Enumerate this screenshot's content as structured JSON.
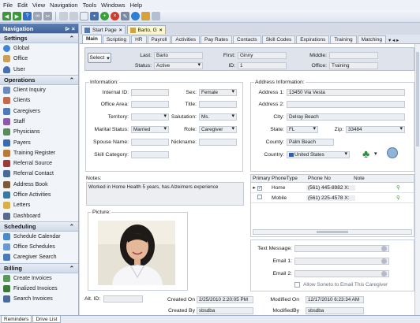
{
  "menu": [
    "File",
    "Edit",
    "View",
    "Navigation",
    "Tools",
    "Windows",
    "Help"
  ],
  "nav": {
    "title": "Navigation",
    "pin": "⊳ ×",
    "sections": [
      {
        "label": "Settings",
        "items": [
          "Global",
          "Office",
          "User"
        ]
      },
      {
        "label": "Operations",
        "items": [
          "Client Inquiry",
          "Clients",
          "Caregivers",
          "Staff",
          "Physicians",
          "Payers",
          "Training Register",
          "Referral Source",
          "Referral Contact",
          "Address Book",
          "Office Activities",
          "Letters",
          "Dashboard"
        ]
      },
      {
        "label": "Scheduling",
        "items": [
          "Schedule Calendar",
          "Office Schedules",
          "Caregiver Search"
        ]
      },
      {
        "label": "Billing",
        "items": [
          "Create Invoices",
          "Finalized Invoices",
          "Search Invoices"
        ]
      }
    ]
  },
  "bottom_tabs": [
    "Reminders",
    "Drive List"
  ],
  "doc_tabs": [
    "Start Page",
    "Barto, G"
  ],
  "sub_tabs": [
    "Main",
    "Scripting",
    "HR",
    "Payroll",
    "Activities",
    "Pay Rates",
    "Contacts",
    "Skill Codes",
    "Expirations",
    "Training",
    "Matching"
  ],
  "header": {
    "select_label": "Select",
    "last_label": "Last:",
    "last": "Barto",
    "first_label": "First:",
    "first": "Ginny",
    "middle_label": "Middle:",
    "middle": "",
    "status_label": "Status:",
    "status": "Active",
    "id_label": "ID:",
    "id": "1",
    "office_label": "Office:",
    "office": "Training"
  },
  "info": {
    "title": "Information:",
    "internal_id_label": "Internal ID:",
    "internal_id": "",
    "sex_label": "Sex:",
    "sex": "Female",
    "office_area_label": "Office Area:",
    "office_area": "",
    "title_label": "Title:",
    "title_value": "",
    "territory_label": "Territory:",
    "territory": "",
    "salutation_label": "Salutation:",
    "salutation": "Ms.",
    "marital_label": "Marital Status:",
    "marital": "Married",
    "role_label": "Role:",
    "role": "Caregiver",
    "spouse_label": "Spouse Name:",
    "spouse": "",
    "nickname_label": "Nickname:",
    "nickname": "",
    "skill_label": "Skill Category:",
    "skill": ""
  },
  "address": {
    "title": "Address Information:",
    "a1_label": "Address 1:",
    "a1": "13450 Via Vesta",
    "a2_label": "Address 2:",
    "a2": "",
    "city_label": "City:",
    "city": "Delray Beach",
    "state_label": "State:",
    "state": "FL",
    "zip_label": "Zip:",
    "zip": "33484",
    "county_label": "County:",
    "county": "Palm Beach",
    "country_label": "Country:",
    "country": "United States"
  },
  "notes": {
    "label": "Notes:",
    "text": "Worked in Home Health 5 years, has Alzeimers experience"
  },
  "picture_label": "Picture:",
  "phones": {
    "columns": [
      "Primary",
      "PhoneType",
      "Phone No",
      "Note"
    ],
    "rows": [
      {
        "type": "Home",
        "number": "(561) 445-8982 X:",
        "note": ""
      },
      {
        "type": "Mobile",
        "number": "(561) 225-4578 X:",
        "note": ""
      }
    ]
  },
  "contact": {
    "text_label": "Text Message:",
    "text": "",
    "email1_label": "Email 1:",
    "email1": "",
    "email2_label": "Email 2:",
    "email2": "",
    "allow_label": "Allow Soneto to Email This Caregiver"
  },
  "footer": {
    "alt_label": "Alt. ID:",
    "alt": "",
    "created_on_label": "Created On",
    "created_on": "2/25/2010 2:20:05 PM",
    "modified_on_label": "Modified On",
    "modified_on": "12/17/2010 6:23:34 AM",
    "created_by_label": "Created By",
    "created_by": "sbsdba",
    "modified_by_label": "ModifiedBy",
    "modified_by": "sbsdba"
  },
  "colors": {
    "nav_header": "#3f6299",
    "active_tab": "#fff7cc"
  }
}
